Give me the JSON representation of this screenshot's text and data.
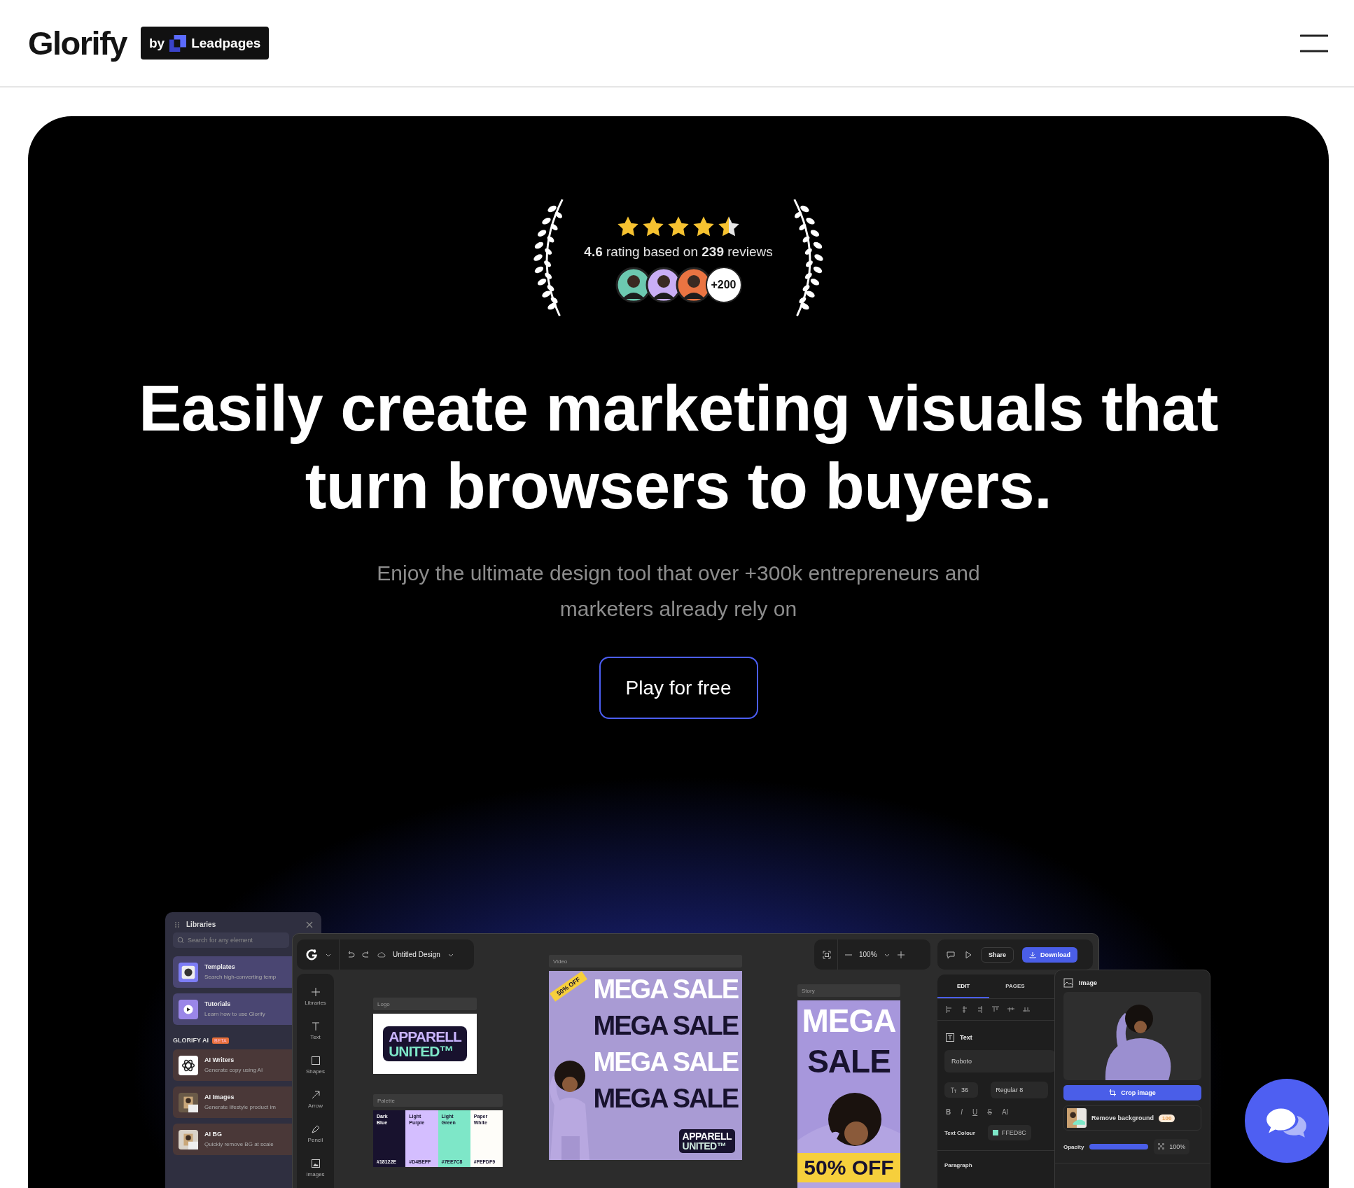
{
  "header": {
    "logo": "Glorify",
    "badge": {
      "by": "by",
      "brand": "Leadpages"
    }
  },
  "rating": {
    "stars": 4.5,
    "text": "**4.6** rating based on **239** reviews",
    "more": "+200",
    "avatars": [
      {
        "color": "#6cc9b0"
      },
      {
        "color": "#c9aef5"
      },
      {
        "color": "#ea7442"
      }
    ]
  },
  "headline": "Easily create marketing visuals that turn browsers to buyers.",
  "subtitle": "Enjoy the ultimate design tool that over +300k entrepreneurs and marketers already rely on",
  "cta": "Play for free",
  "app": {
    "libraries": {
      "title": "Libraries",
      "search_placeholder": "Search for any element",
      "items": [
        {
          "title": "Templates",
          "subtitle": "Search high-converting temp"
        },
        {
          "title": "Tutorials",
          "subtitle": "Learn how to use Glorify"
        }
      ],
      "ai_title": "GLORIFY AI",
      "ai_badge": "BETA",
      "ai_items": [
        {
          "title": "AI Writers",
          "subtitle": "Generate copy using AI"
        },
        {
          "title": "AI Images",
          "subtitle": "Generate lifestyle product im"
        },
        {
          "title": "AI BG",
          "subtitle": "Quickly remove BG at scale"
        }
      ]
    },
    "toolbar": {
      "design_name": "Untitled Design",
      "zoom": "100%",
      "share": "Share",
      "download": "Download"
    },
    "tools": [
      {
        "label": "Libraries"
      },
      {
        "label": "Text"
      },
      {
        "label": "Shapes"
      },
      {
        "label": "Arrow"
      },
      {
        "label": "Pencil"
      },
      {
        "label": "Images"
      }
    ],
    "logo_card": {
      "title": "Logo",
      "lines": [
        "APPARELL",
        "UNITED™"
      ]
    },
    "palette_card": {
      "title": "Palette",
      "swatches": [
        {
          "name": "Dark Blue",
          "hex": "#18122E",
          "color": "#18122e"
        },
        {
          "name": "Light Purple",
          "hex": "#D4BEFF",
          "color": "#d4beff"
        },
        {
          "name": "Light Green",
          "hex": "#7EE7C8",
          "color": "#7ee7c8"
        },
        {
          "name": "Paper White",
          "hex": "#FEFDF9",
          "color": "#fefdf9"
        }
      ]
    },
    "video_card": {
      "title": "Video",
      "ribbon": "50% OFF",
      "logo_lines": [
        "APPARELL",
        "UNITED™"
      ],
      "lines": [
        {
          "text": "MEGA SALE",
          "color": "#ffffff"
        },
        {
          "text": "MEGA SALE",
          "color": "#18122e"
        },
        {
          "text": "MEGA SALE",
          "color": "#ffffff"
        },
        {
          "text": "MEGA SALE",
          "color": "#18122e"
        }
      ]
    },
    "story_card": {
      "title": "Story",
      "banner": "50% OFF",
      "lines": [
        {
          "text": "MEGA",
          "color": "#ffffff"
        },
        {
          "text": "SALE",
          "color": "#18122e"
        }
      ]
    },
    "edit_panel": {
      "tabs": [
        {
          "label": "EDIT",
          "selected": true
        },
        {
          "label": "PAGES",
          "selected": false
        }
      ],
      "section": "Text",
      "font": "Roboto",
      "size": "36",
      "weight": "Regular 8",
      "styles": [
        "B",
        "I",
        "U",
        "S",
        "AI"
      ],
      "colour_label": "Text Colour",
      "colour": {
        "value": "FFED8C",
        "color": "#7ee7c8"
      },
      "paragraph": "Paragraph"
    },
    "image_panel": {
      "title": "Image",
      "crop": "Crop image",
      "remove_bg": "Remove background",
      "credits": "100",
      "opacity_label": "Opacity",
      "opacity": {
        "level": 1
      },
      "opacity_reading": "100%"
    }
  }
}
